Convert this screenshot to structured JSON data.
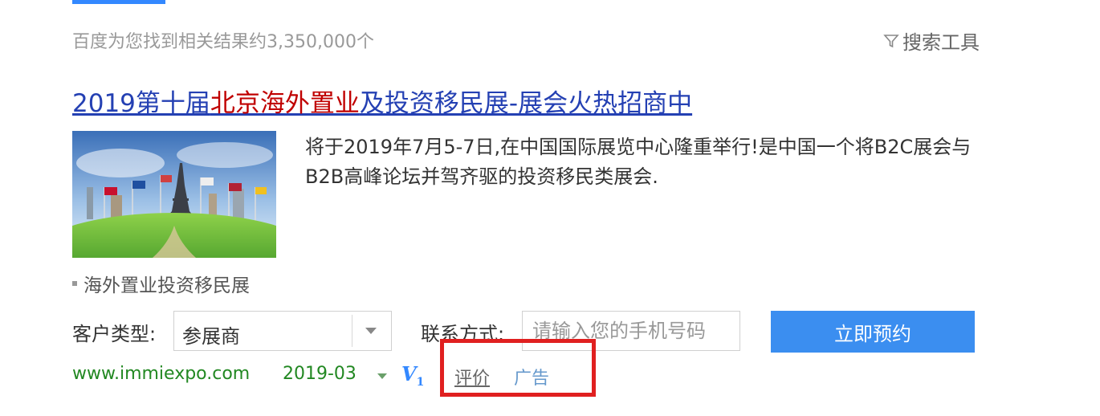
{
  "header": {
    "result_count": "百度为您找到相关结果约3,350,000个",
    "search_tools": "搜索工具",
    "search_tools_icon": "filter-icon"
  },
  "result": {
    "title_part1": "2019第十届",
    "title_highlight": "北京海外置业",
    "title_part2": "及投资移民展-展会火热招商中",
    "description": "将于2019年7月5-7日,在中国国际展览中心隆重举行!是中国一个将B2C展会与B2B高峰论坛并驾齐驱的投资移民类展会.",
    "image_caption": "海外置业投资移民展",
    "thumbnail": "eiffel-tower-flags-green-lawn-image"
  },
  "form": {
    "customer_type_label": "客户类型:",
    "customer_type_value": "参展商",
    "contact_label": "联系方式:",
    "phone_placeholder": "请输入您的手机号码",
    "submit_label": "立即预约"
  },
  "meta": {
    "url": "www.immiexpo.com",
    "date": "2019-03",
    "v_badge": "V",
    "v_level": "1",
    "review_label": "评价",
    "ad_label": "广告"
  },
  "colors": {
    "title_link": "#2440b3",
    "title_highlight": "#c00000",
    "url_green": "#228822",
    "button_blue": "#3b8ef0",
    "annotation_red": "#e02020"
  }
}
